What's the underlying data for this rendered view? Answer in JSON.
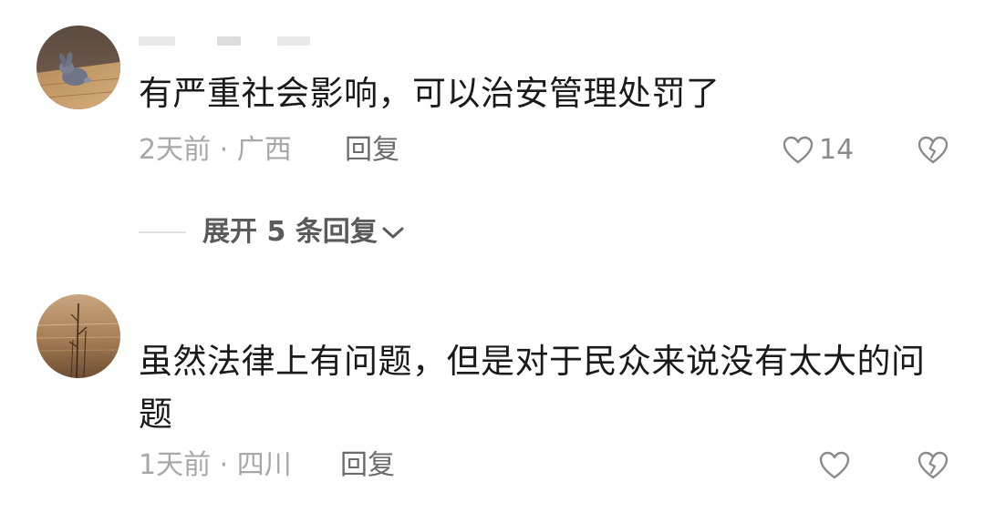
{
  "comments": [
    {
      "text": "有严重社会影响，可以治安管理处罚了",
      "meta": "2天前 · 广西",
      "reply_label": "回复",
      "likes": "14",
      "avatar_icon": "rabbit-avatar-icon"
    },
    {
      "text": "虽然法律上有问题，但是对于民众来说没有太大的问题",
      "meta": "1天前 · 四川",
      "reply_label": "回复",
      "likes": "",
      "avatar_icon": "reeds-sunset-avatar-icon"
    }
  ],
  "expand_replies": {
    "label": "展开 5 条回复",
    "icon": "chevron-down-icon"
  },
  "icons": {
    "like": "heart-outline-icon",
    "dislike": "broken-heart-outline-icon"
  },
  "colors": {
    "text_primary": "#1a1a1a",
    "text_meta": "#a8a8a8",
    "text_reply": "#6b6b6b",
    "icon_gray": "#8a8a8a"
  }
}
